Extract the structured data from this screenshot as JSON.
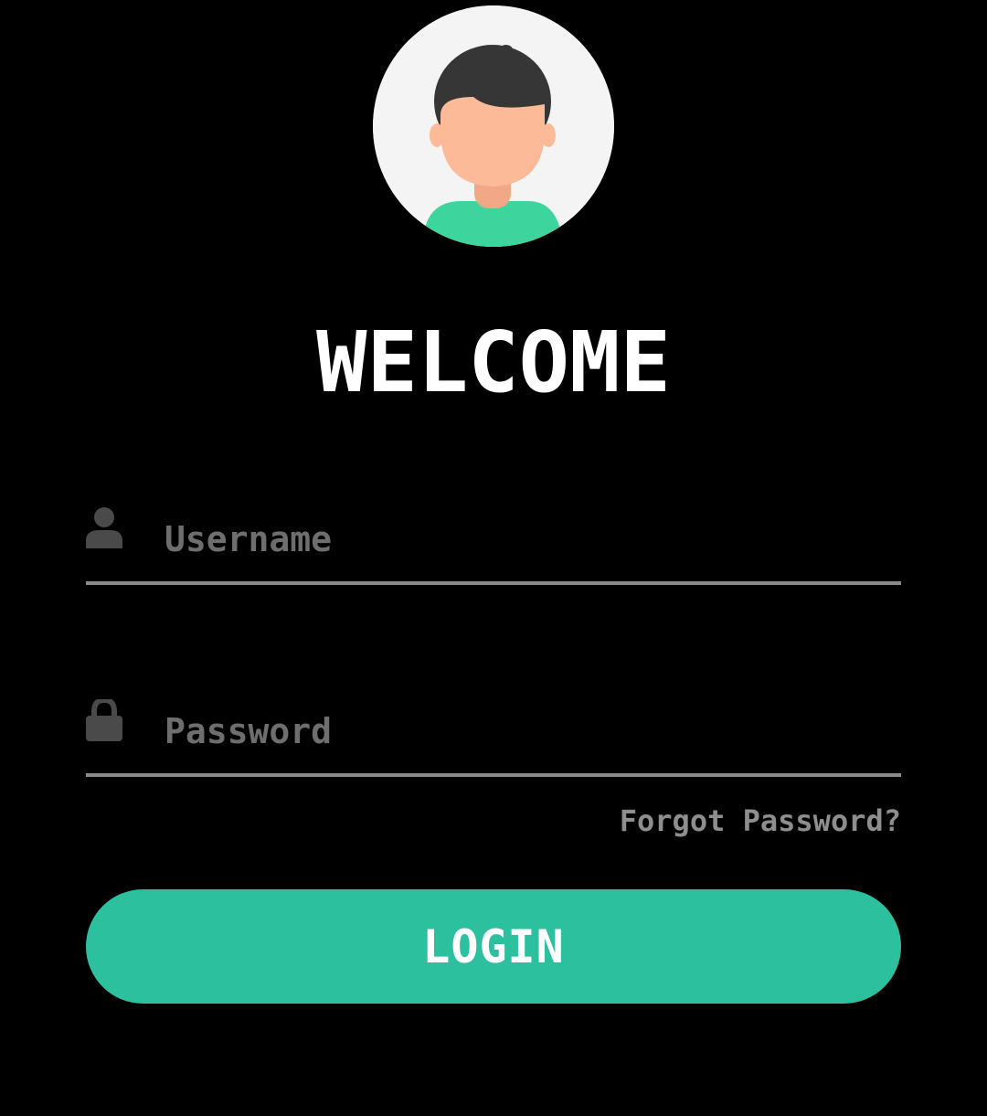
{
  "header": {
    "title": "WELCOME"
  },
  "avatar": {
    "icon": "user-avatar-illustration",
    "colors": {
      "background": "#f4f4f4",
      "hair": "#363636",
      "skin": "#fcba98",
      "shirt": "#3dd49e"
    }
  },
  "form": {
    "username": {
      "icon": "person-icon",
      "placeholder": "Username",
      "value": ""
    },
    "password": {
      "icon": "lock-icon",
      "placeholder": "Password",
      "value": ""
    },
    "forgot_label": "Forgot Password?",
    "login_label": "LOGIN"
  },
  "colors": {
    "background": "#000000",
    "accent": "#2cc09f",
    "placeholder": "#6e6e6e",
    "underline": "#8a8a8a",
    "link": "#8e8e8e"
  }
}
